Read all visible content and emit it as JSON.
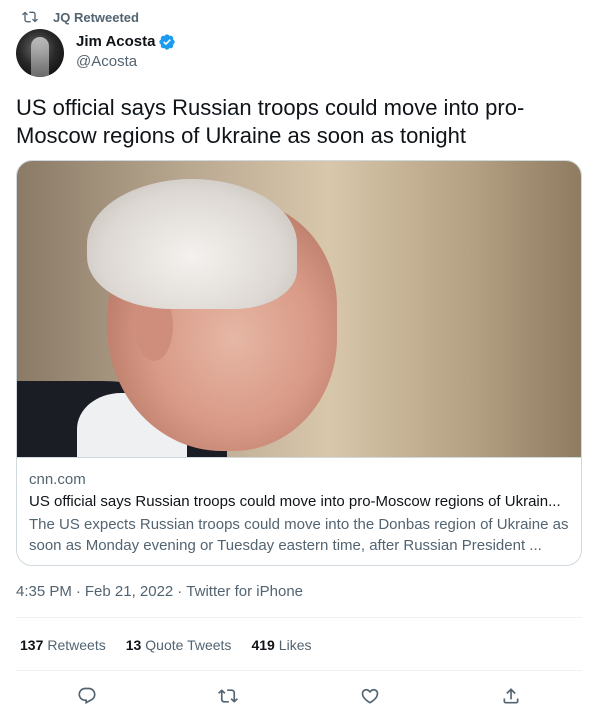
{
  "retweet_context": {
    "label": "JQ Retweeted"
  },
  "author": {
    "display_name": "Jim Acosta",
    "handle": "@Acosta",
    "verified": true
  },
  "tweet": {
    "text": "US official says Russian troops could move into pro-Moscow regions of Ukraine as soon as tonight"
  },
  "card": {
    "domain": "cnn.com",
    "title": "US official says Russian troops could move into pro-Moscow regions of Ukrain...",
    "description": "The US expects Russian troops could move into the Donbas region of Ukraine as soon as Monday evening or Tuesday eastern time, after Russian President ..."
  },
  "meta": {
    "time": "4:35 PM",
    "date": "Feb 21, 2022",
    "source": "Twitter for iPhone",
    "separator": "·"
  },
  "stats": {
    "retweets_count": "137",
    "retweets_label": "Retweets",
    "quotes_count": "13",
    "quotes_label": "Quote Tweets",
    "likes_count": "419",
    "likes_label": "Likes"
  },
  "icons": {
    "retweet_context": "retweet-icon",
    "verified": "verified-badge-icon",
    "reply": "reply-icon",
    "retweet": "retweet-icon",
    "like": "heart-icon",
    "share": "share-icon"
  },
  "colors": {
    "accent": "#1d9bf0",
    "secondary_text": "#536471",
    "border": "#cfd9de"
  }
}
